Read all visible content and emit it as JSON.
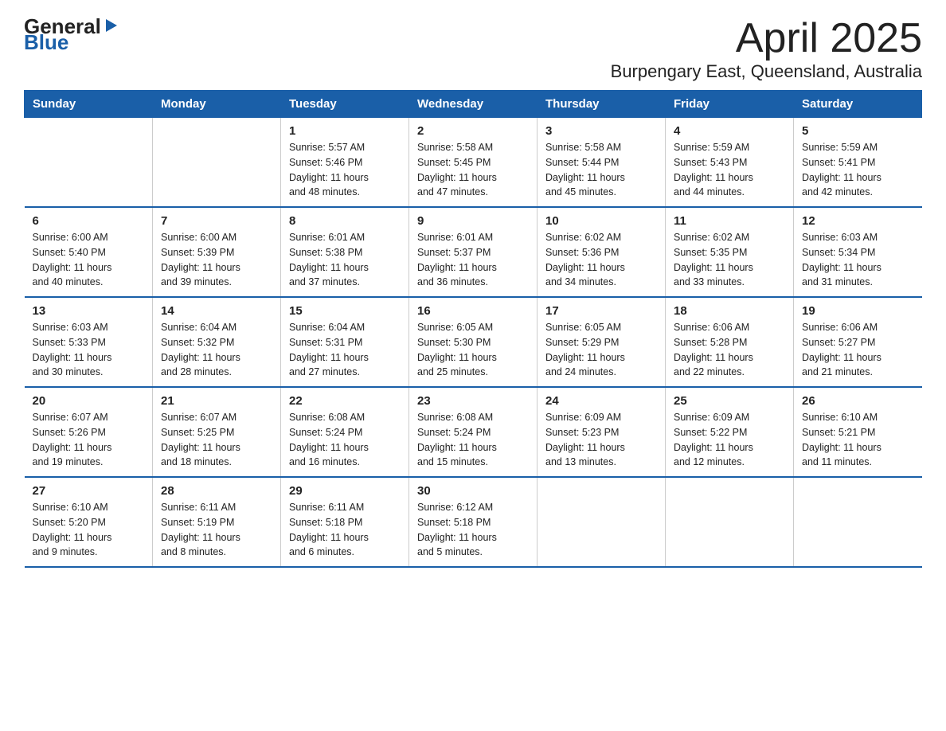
{
  "logo": {
    "general": "General",
    "blue": "Blue",
    "arrow": "▶"
  },
  "header": {
    "month": "April 2025",
    "location": "Burpengary East, Queensland, Australia"
  },
  "weekdays": [
    "Sunday",
    "Monday",
    "Tuesday",
    "Wednesday",
    "Thursday",
    "Friday",
    "Saturday"
  ],
  "weeks": [
    [
      {
        "day": "",
        "info": ""
      },
      {
        "day": "",
        "info": ""
      },
      {
        "day": "1",
        "info": "Sunrise: 5:57 AM\nSunset: 5:46 PM\nDaylight: 11 hours\nand 48 minutes."
      },
      {
        "day": "2",
        "info": "Sunrise: 5:58 AM\nSunset: 5:45 PM\nDaylight: 11 hours\nand 47 minutes."
      },
      {
        "day": "3",
        "info": "Sunrise: 5:58 AM\nSunset: 5:44 PM\nDaylight: 11 hours\nand 45 minutes."
      },
      {
        "day": "4",
        "info": "Sunrise: 5:59 AM\nSunset: 5:43 PM\nDaylight: 11 hours\nand 44 minutes."
      },
      {
        "day": "5",
        "info": "Sunrise: 5:59 AM\nSunset: 5:41 PM\nDaylight: 11 hours\nand 42 minutes."
      }
    ],
    [
      {
        "day": "6",
        "info": "Sunrise: 6:00 AM\nSunset: 5:40 PM\nDaylight: 11 hours\nand 40 minutes."
      },
      {
        "day": "7",
        "info": "Sunrise: 6:00 AM\nSunset: 5:39 PM\nDaylight: 11 hours\nand 39 minutes."
      },
      {
        "day": "8",
        "info": "Sunrise: 6:01 AM\nSunset: 5:38 PM\nDaylight: 11 hours\nand 37 minutes."
      },
      {
        "day": "9",
        "info": "Sunrise: 6:01 AM\nSunset: 5:37 PM\nDaylight: 11 hours\nand 36 minutes."
      },
      {
        "day": "10",
        "info": "Sunrise: 6:02 AM\nSunset: 5:36 PM\nDaylight: 11 hours\nand 34 minutes."
      },
      {
        "day": "11",
        "info": "Sunrise: 6:02 AM\nSunset: 5:35 PM\nDaylight: 11 hours\nand 33 minutes."
      },
      {
        "day": "12",
        "info": "Sunrise: 6:03 AM\nSunset: 5:34 PM\nDaylight: 11 hours\nand 31 minutes."
      }
    ],
    [
      {
        "day": "13",
        "info": "Sunrise: 6:03 AM\nSunset: 5:33 PM\nDaylight: 11 hours\nand 30 minutes."
      },
      {
        "day": "14",
        "info": "Sunrise: 6:04 AM\nSunset: 5:32 PM\nDaylight: 11 hours\nand 28 minutes."
      },
      {
        "day": "15",
        "info": "Sunrise: 6:04 AM\nSunset: 5:31 PM\nDaylight: 11 hours\nand 27 minutes."
      },
      {
        "day": "16",
        "info": "Sunrise: 6:05 AM\nSunset: 5:30 PM\nDaylight: 11 hours\nand 25 minutes."
      },
      {
        "day": "17",
        "info": "Sunrise: 6:05 AM\nSunset: 5:29 PM\nDaylight: 11 hours\nand 24 minutes."
      },
      {
        "day": "18",
        "info": "Sunrise: 6:06 AM\nSunset: 5:28 PM\nDaylight: 11 hours\nand 22 minutes."
      },
      {
        "day": "19",
        "info": "Sunrise: 6:06 AM\nSunset: 5:27 PM\nDaylight: 11 hours\nand 21 minutes."
      }
    ],
    [
      {
        "day": "20",
        "info": "Sunrise: 6:07 AM\nSunset: 5:26 PM\nDaylight: 11 hours\nand 19 minutes."
      },
      {
        "day": "21",
        "info": "Sunrise: 6:07 AM\nSunset: 5:25 PM\nDaylight: 11 hours\nand 18 minutes."
      },
      {
        "day": "22",
        "info": "Sunrise: 6:08 AM\nSunset: 5:24 PM\nDaylight: 11 hours\nand 16 minutes."
      },
      {
        "day": "23",
        "info": "Sunrise: 6:08 AM\nSunset: 5:24 PM\nDaylight: 11 hours\nand 15 minutes."
      },
      {
        "day": "24",
        "info": "Sunrise: 6:09 AM\nSunset: 5:23 PM\nDaylight: 11 hours\nand 13 minutes."
      },
      {
        "day": "25",
        "info": "Sunrise: 6:09 AM\nSunset: 5:22 PM\nDaylight: 11 hours\nand 12 minutes."
      },
      {
        "day": "26",
        "info": "Sunrise: 6:10 AM\nSunset: 5:21 PM\nDaylight: 11 hours\nand 11 minutes."
      }
    ],
    [
      {
        "day": "27",
        "info": "Sunrise: 6:10 AM\nSunset: 5:20 PM\nDaylight: 11 hours\nand 9 minutes."
      },
      {
        "day": "28",
        "info": "Sunrise: 6:11 AM\nSunset: 5:19 PM\nDaylight: 11 hours\nand 8 minutes."
      },
      {
        "day": "29",
        "info": "Sunrise: 6:11 AM\nSunset: 5:18 PM\nDaylight: 11 hours\nand 6 minutes."
      },
      {
        "day": "30",
        "info": "Sunrise: 6:12 AM\nSunset: 5:18 PM\nDaylight: 11 hours\nand 5 minutes."
      },
      {
        "day": "",
        "info": ""
      },
      {
        "day": "",
        "info": ""
      },
      {
        "day": "",
        "info": ""
      }
    ]
  ]
}
